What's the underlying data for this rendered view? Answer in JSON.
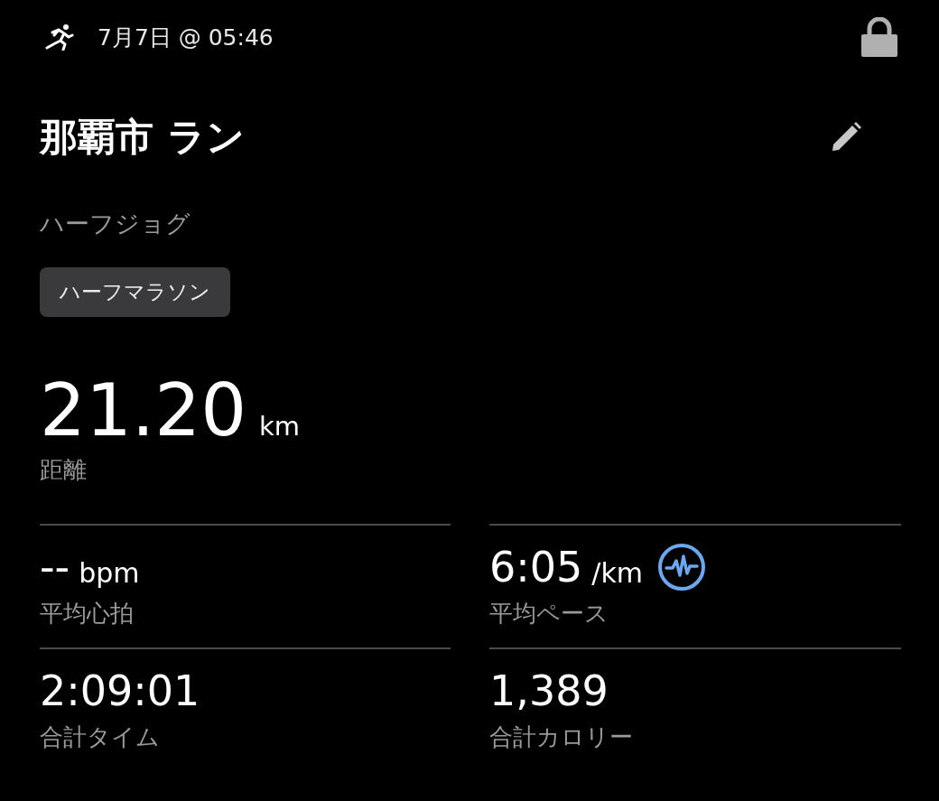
{
  "header": {
    "date": "7月7日 @ 05:46"
  },
  "title": "那覇市 ラン",
  "subtitle": "ハーフジョグ",
  "tag": "ハーフマラソン",
  "distance": {
    "value": "21.20",
    "unit": "km",
    "label": "距離"
  },
  "stats": [
    {
      "value": "--",
      "unit": "bpm",
      "label": "平均心拍",
      "kind": "plain"
    },
    {
      "value": "6:05",
      "unit": "/km",
      "label": "平均ペース",
      "kind": "pace"
    },
    {
      "value": "2:09:01",
      "label": "合計タイム",
      "kind": "plain"
    },
    {
      "value": "1,389",
      "label": "合計カロリー",
      "kind": "plain"
    }
  ]
}
